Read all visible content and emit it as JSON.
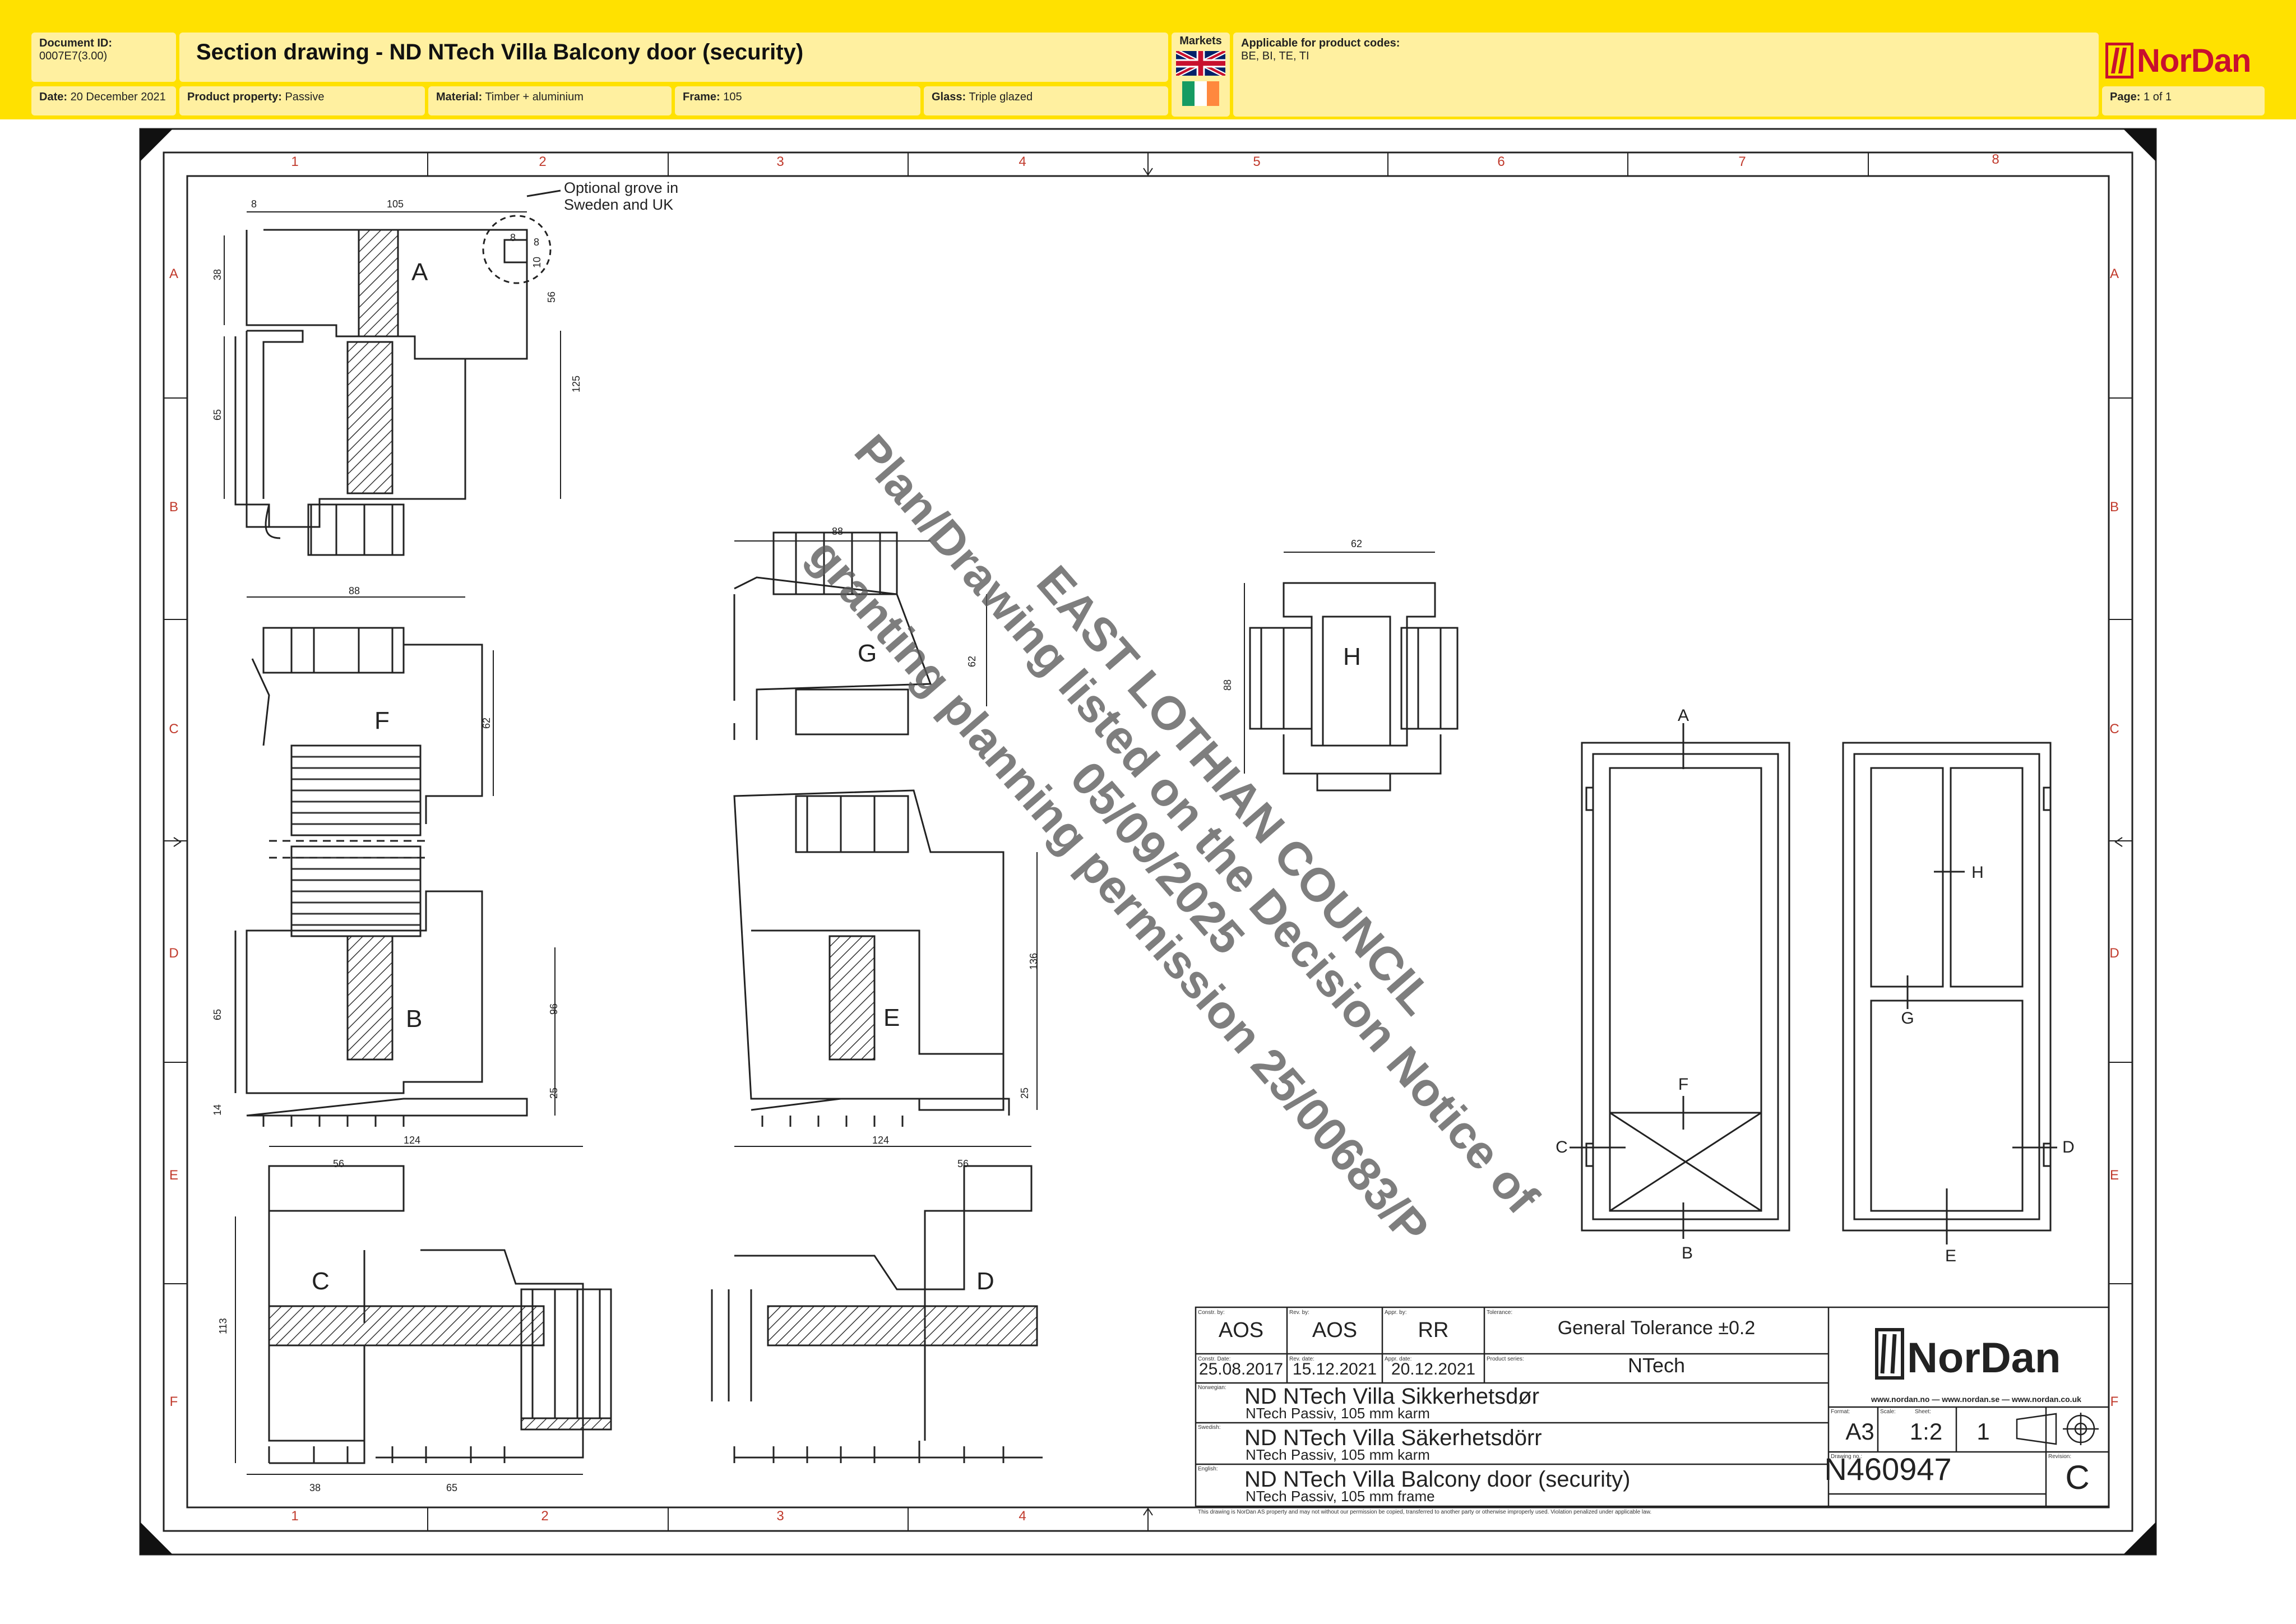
{
  "header": {
    "document_id_label": "Document ID:",
    "document_id": "0007E7(3.00)",
    "title": "Section drawing - ND NTech Villa Balcony door (security)",
    "markets_label": "Markets",
    "applicable_label": "Applicable for product codes:",
    "applicable_codes": "BE, BI, TE, TI",
    "date_label": "Date:",
    "date": "20 December 2021",
    "property_label": "Product property:",
    "property": "Passive",
    "material_label": "Material:",
    "material": "Timber + aluminium",
    "frame_label": "Frame:",
    "frame": "105",
    "glass_label": "Glass:",
    "glass": "Triple glazed",
    "page_label": "Page:",
    "page": "1 of 1",
    "logo_text": "NorDan"
  },
  "drawing": {
    "columns": [
      "1",
      "2",
      "3",
      "4",
      "5",
      "6",
      "7",
      "8"
    ],
    "rows": [
      "A",
      "B",
      "C",
      "D",
      "E",
      "F"
    ],
    "note": "Optional grove in\nSweden and UK",
    "section_labels": [
      "A",
      "B",
      "C",
      "D",
      "E",
      "F",
      "G",
      "H"
    ],
    "dims": {
      "d8": "8",
      "d105": "105",
      "d38": "38",
      "d65": "65",
      "d88": "88",
      "d125": "125",
      "d56": "56",
      "d10": "10",
      "d62": "62",
      "d96": "96",
      "d25": "25",
      "d14": "14",
      "d124": "124",
      "d113": "113",
      "d136": "136"
    }
  },
  "watermark": {
    "line1": "EAST LOTHIAN COUNCIL",
    "line2": "Plan/Drawing listed on the Decision Notice of",
    "line3": "05/09/2025",
    "line4": "granting planning permission 25/00683/P"
  },
  "title_block": {
    "const_by_label": "Constr. by:",
    "const_by": "AOS",
    "rev_by_label": "Rev. by:",
    "rev_by": "AOS",
    "appr_by_label": "Appr. by:",
    "appr_by": "RR",
    "tolerance_label": "Tolerance:",
    "tolerance": "General Tolerance ±0.2",
    "const_date_label": "Constr. Date:",
    "const_date": "25.08.2017",
    "rev_date_label": "Rev. date:",
    "rev_date": "15.12.2021",
    "appr_date_label": "Appr. date:",
    "appr_date": "20.12.2021",
    "product_series_label": "Product series:",
    "product_series": "NTech",
    "lang_no": "Norwegian:",
    "name_no": "ND NTech Villa Sikkerhetsdør",
    "sub_no": "NTech Passiv, 105 mm karm",
    "lang_se": "Swedish:",
    "name_se": "ND NTech Villa Säkerhetsdörr",
    "sub_se": "NTech Passiv, 105 mm karm",
    "lang_en": "English:",
    "name_en": "ND NTech Villa Balcony door (security)",
    "sub_en": "NTech Passiv, 105 mm frame",
    "logo_text": "NorDan",
    "websites": "www.nordan.no — www.nordan.se — www.nordan.co.uk",
    "format_label": "Format:",
    "format": "A3",
    "scale_label": "Scale:",
    "scale": "1:2",
    "sheet_label": "Sheet:",
    "sheet": "1",
    "drawing_no_label": "Drawing no.:",
    "drawing_no": "N460947",
    "revision_label": "Revision:",
    "revision": "C",
    "footer_note": "This drawing is NorDan AS property and may not without our permission be copied, transferred to another party or otherwise improperly used. Violation penalized under applicable law."
  },
  "colors": {
    "header_yellow": "#ffe100",
    "cell_bg": "#fff0a0",
    "brand_red": "#c8102e",
    "grid_red": "#c0392b"
  }
}
